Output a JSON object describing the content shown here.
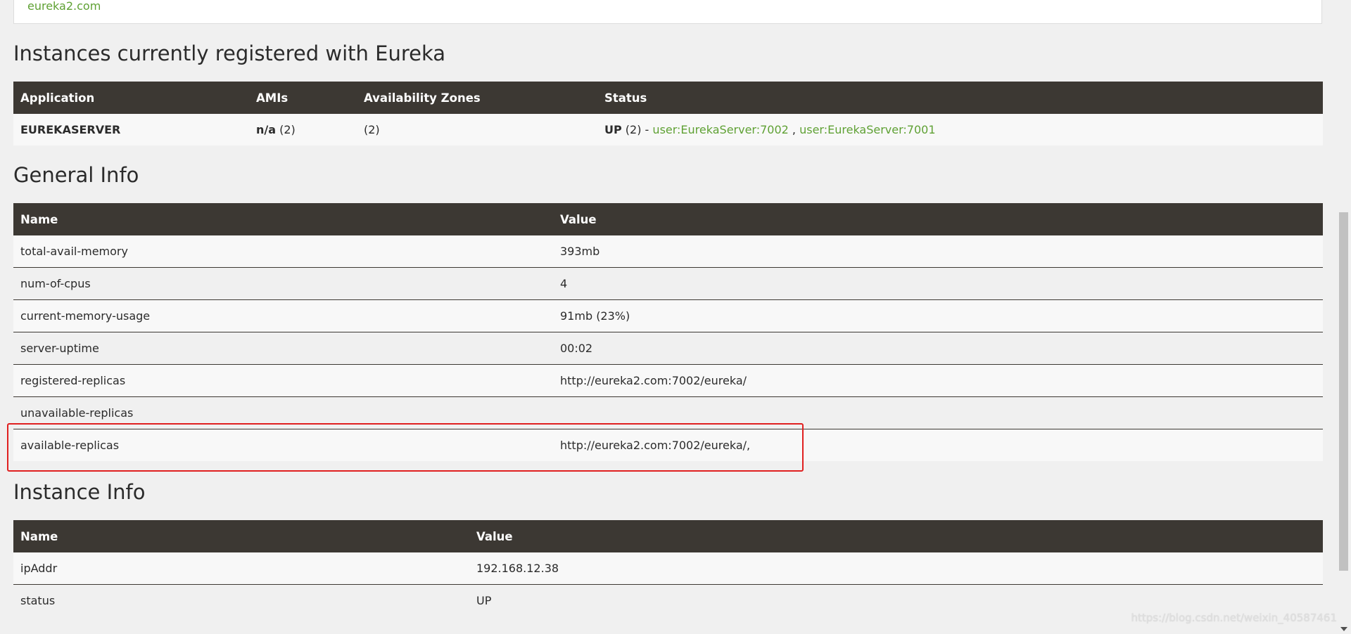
{
  "top_panel": {
    "link": "eureka2.com"
  },
  "instances": {
    "title": "Instances currently registered with Eureka",
    "headers": [
      "Application",
      "AMIs",
      "Availability Zones",
      "Status"
    ],
    "row": {
      "application": "EUREKASERVER",
      "amis_bold": "n/a",
      "amis_count": " (2)",
      "zones": "(2)",
      "status_prefix": "UP",
      "status_count": " (2) - ",
      "link1": "user:EurekaServer:7002",
      "separator": " , ",
      "link2": "user:EurekaServer:7001"
    }
  },
  "general_info": {
    "title": "General Info",
    "headers": [
      "Name",
      "Value"
    ],
    "rows": [
      {
        "name": "total-avail-memory",
        "value": "393mb"
      },
      {
        "name": "num-of-cpus",
        "value": "4"
      },
      {
        "name": "current-memory-usage",
        "value": "91mb (23%)"
      },
      {
        "name": "server-uptime",
        "value": "00:02"
      },
      {
        "name": "registered-replicas",
        "value": "http://eureka2.com:7002/eureka/"
      },
      {
        "name": "unavailable-replicas",
        "value": ""
      },
      {
        "name": "available-replicas",
        "value": "http://eureka2.com:7002/eureka/,"
      }
    ]
  },
  "instance_info": {
    "title": "Instance Info",
    "headers": [
      "Name",
      "Value"
    ],
    "rows": [
      {
        "name": "ipAddr",
        "value": "192.168.12.38"
      },
      {
        "name": "status",
        "value": "UP"
      }
    ]
  },
  "watermark": "https://blog.csdn.net/weixin_40587461",
  "colors": {
    "header_bg": "#3c3833",
    "link_green": "#5fa134",
    "highlight_red": "#e02020",
    "page_bg": "#f0f0f0"
  }
}
